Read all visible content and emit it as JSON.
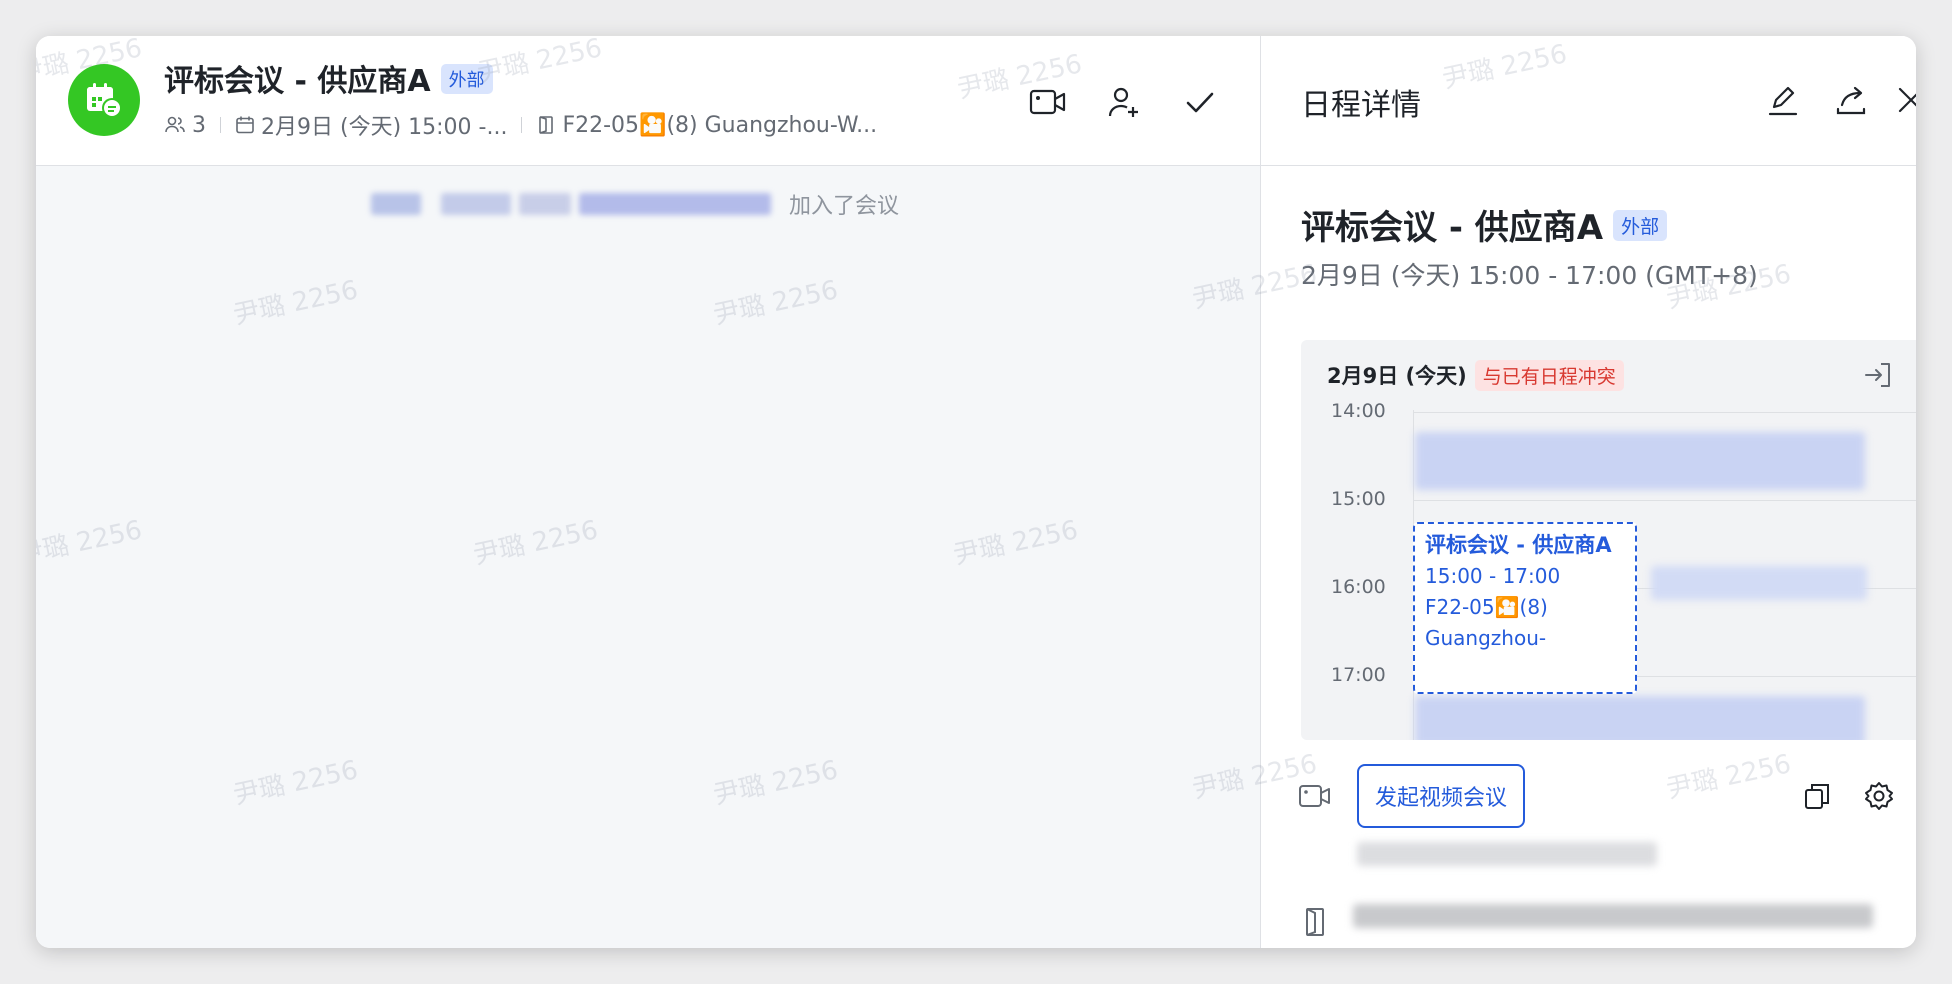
{
  "chat": {
    "title": "评标会议 - 供应商A",
    "external_tag": "外部",
    "member_count": "3",
    "date_summary": "2月9日 (今天) 15:00 -...",
    "room_summary": "F22-05🎦(8) Guangzhou-W...",
    "join_message": "加入了会议",
    "header_icons": [
      "video-camera-icon",
      "add-member-icon",
      "checkmark-icon"
    ]
  },
  "panel": {
    "title": "日程详情",
    "header_icons": [
      "edit-pencil-icon",
      "share-icon",
      "close-icon"
    ],
    "event_title": "评标会议 - 供应商A",
    "external_tag": "外部",
    "event_time": "2月9日 (今天) 15:00 - 17:00 (GMT+8)",
    "calendar": {
      "date_label": "2月9日 (今天)",
      "conflict_label": "与已有日程冲突",
      "hours": [
        "14:00",
        "15:00",
        "16:00",
        "17:00"
      ],
      "selected_event": {
        "title": "评标会议 - 供应商A",
        "time": "15:00 - 17:00",
        "room_line1": "F22-05🎦(8)",
        "room_line2": "Guangzhou-"
      }
    },
    "video_button_label": "发起视频会议",
    "room_closing_paren": ")"
  },
  "watermark_text": "尹璐 2256",
  "colors": {
    "accent_blue": "#245bdb",
    "avatar_green": "#34c724",
    "conflict_red": "#d83931"
  }
}
